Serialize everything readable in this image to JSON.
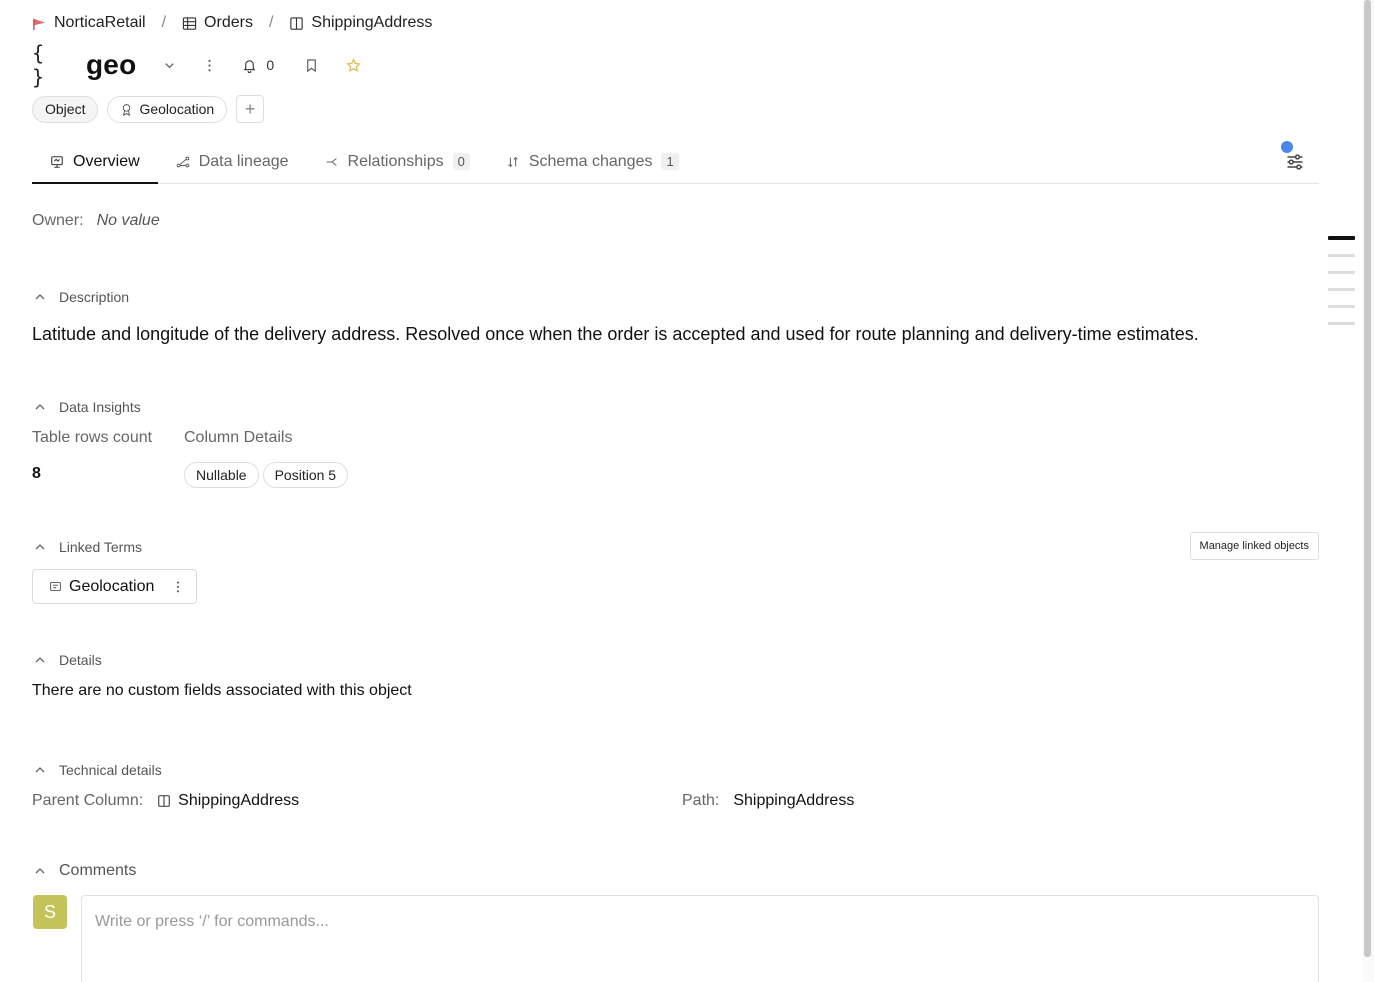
{
  "breadcrumb": {
    "items": [
      {
        "label": "NorticaRetail",
        "icon": "brand-flag-icon"
      },
      {
        "label": "Orders",
        "icon": "table-icon"
      },
      {
        "label": "ShippingAddress",
        "icon": "column-icon"
      }
    ],
    "separator": "/"
  },
  "header": {
    "type_glyph": "{ }",
    "title": "geo",
    "notifications_count": "0"
  },
  "tags": {
    "type_tag": "Object",
    "domain_tag": "Geolocation"
  },
  "tabs": [
    {
      "label": "Overview",
      "icon": "overview-icon",
      "active": true
    },
    {
      "label": "Data lineage",
      "icon": "lineage-icon"
    },
    {
      "label": "Relationships",
      "icon": "relationships-icon",
      "count": "0"
    },
    {
      "label": "Schema changes",
      "icon": "schema-changes-icon",
      "count": "1"
    }
  ],
  "owner": {
    "label": "Owner:",
    "value": "No value"
  },
  "sections": {
    "description": {
      "title": "Description",
      "text": "Latitude and longitude of the delivery address. Resolved once when the order is accepted and used for route planning and delivery-time estimates."
    },
    "insights": {
      "title": "Data Insights",
      "rows_label": "Table rows count",
      "rows_value": "8",
      "columns_label": "Column Details",
      "pills": [
        "Nullable",
        "Position 5"
      ]
    },
    "linked_terms": {
      "title": "Linked Terms",
      "manage_label": "Manage linked objects",
      "term": "Geolocation"
    },
    "details": {
      "title": "Details",
      "empty_text": "There are no custom fields associated with this object"
    },
    "technical": {
      "title": "Technical details",
      "parent_label": "Parent Column:",
      "parent_value": "ShippingAddress",
      "path_label": "Path:",
      "path_value": "ShippingAddress"
    },
    "comments": {
      "title": "Comments",
      "avatar_initial": "S",
      "placeholder": "Write or press ‘/’ for commands..."
    }
  },
  "colors": {
    "accent_dot": "#4a86ee",
    "avatar_bg": "#c4c35a",
    "star": "#e0b84a"
  }
}
